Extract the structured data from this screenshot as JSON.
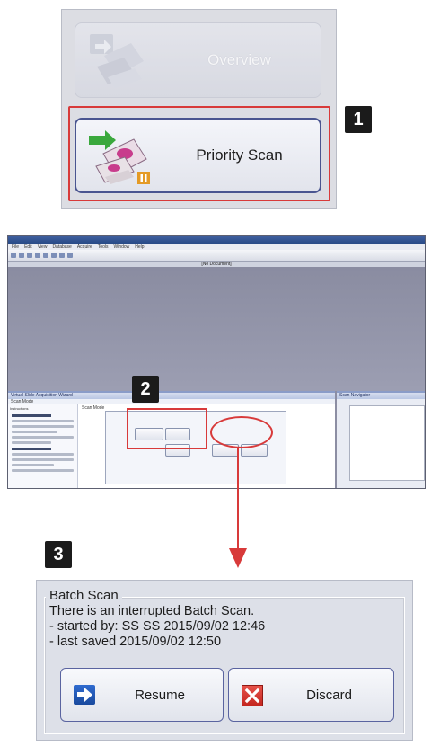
{
  "callouts": [
    "1",
    "2",
    "3"
  ],
  "launcher": {
    "overview_label": "Overview",
    "priority_label": "Priority Scan",
    "highlight_color": "#d83a3a"
  },
  "app": {
    "menu_items": [
      "File",
      "Edit",
      "View",
      "Database",
      "Acquire",
      "Tools",
      "Window",
      "Help"
    ],
    "doc_bar": "[No Document]",
    "panel_title": "Virtual Slide Acquisition Wizard",
    "panel_subtitle": "Scan Mode",
    "instructions_heading": "Instructions",
    "scan_mode_heading": "Scan Mode",
    "navigator_title": "Scan Navigator"
  },
  "batch": {
    "title": "Batch Scan",
    "message_line1": "There is an interrupted Batch Scan.",
    "message_line2": "- started by: SS SS  2015/09/02 12:46",
    "message_line3": "- last saved  2015/09/02 12:50",
    "resume_label": "Resume",
    "discard_label": "Discard"
  }
}
